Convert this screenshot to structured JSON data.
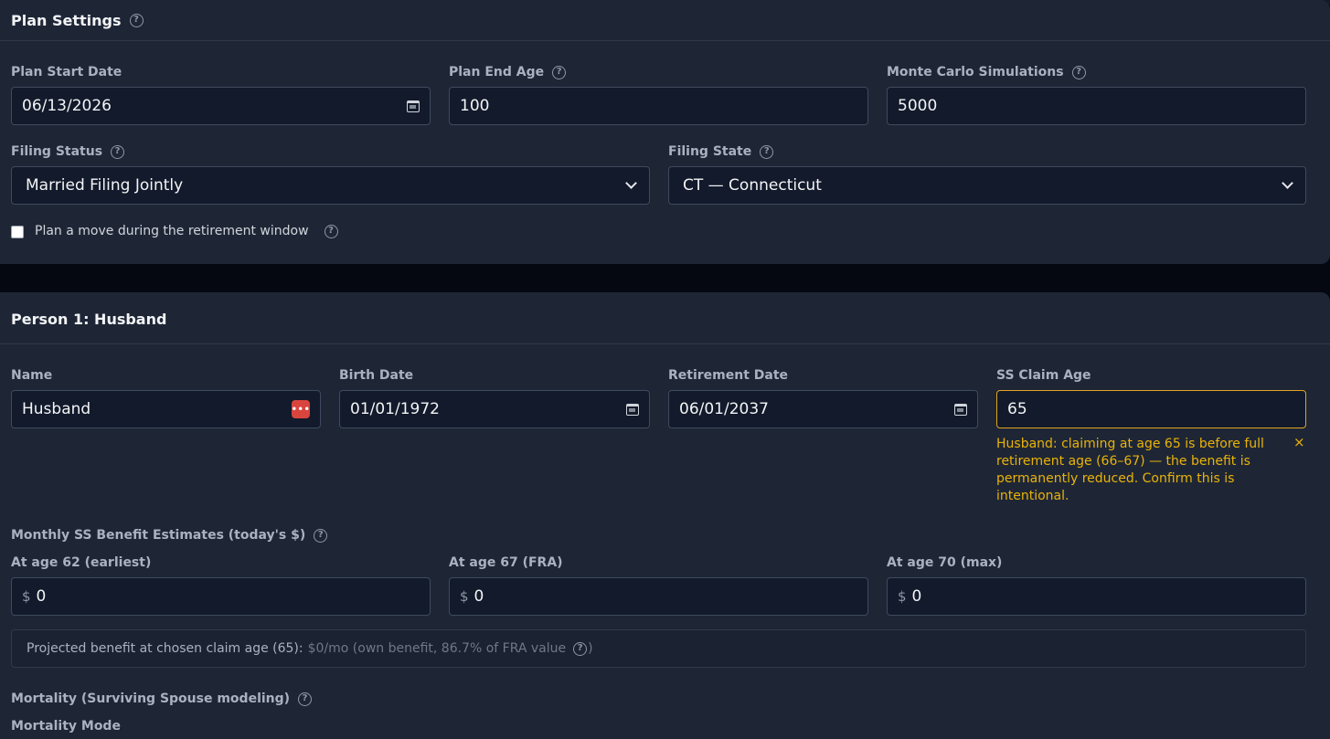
{
  "plan_settings": {
    "title": "Plan Settings",
    "plan_start_date": {
      "label": "Plan Start Date",
      "value": "06/13/2026"
    },
    "plan_end_age": {
      "label": "Plan End Age",
      "value": "100"
    },
    "monte_carlo": {
      "label": "Monte Carlo Simulations",
      "value": "5000"
    },
    "filing_status": {
      "label": "Filing Status",
      "value": "Married Filing Jointly"
    },
    "filing_state": {
      "label": "Filing State",
      "value": "CT — Connecticut"
    },
    "move_checkbox": {
      "label": "Plan a move during the retirement window",
      "checked": false
    }
  },
  "person1": {
    "title": "Person 1: Husband",
    "name": {
      "label": "Name",
      "value": "Husband"
    },
    "birth_date": {
      "label": "Birth Date",
      "value": "01/01/1972"
    },
    "retirement_date": {
      "label": "Retirement Date",
      "value": "06/01/2037"
    },
    "ss_claim_age": {
      "label": "SS Claim Age",
      "value": "65"
    },
    "warning": "Husband: claiming at age 65 is before full retirement age (66–67) — the benefit is permanently reduced. Confirm this is intentional.",
    "warning_close": "×",
    "benefit_estimates": {
      "label": "Monthly SS Benefit Estimates (today's $)",
      "currency": "$",
      "age62": {
        "label": "At age 62 (earliest)",
        "value": "0"
      },
      "age67": {
        "label": "At age 67 (FRA)",
        "value": "0"
      },
      "age70": {
        "label": "At age 70 (max)",
        "value": "0"
      }
    },
    "projected": {
      "label": "Projected benefit at chosen claim age (65):",
      "detail": "$0/mo (own benefit, 86.7% of FRA value",
      "closing": ")"
    },
    "mortality": {
      "label": "Mortality (Surviving Spouse modeling)",
      "mode_label": "Mortality Mode"
    }
  },
  "icons": {
    "help": "?",
    "password": "•••"
  },
  "colors": {
    "background": "#050811",
    "card": "#1e2636",
    "input": "#121a2b",
    "warning": "#eab308",
    "password_badge": "#d9453d"
  }
}
